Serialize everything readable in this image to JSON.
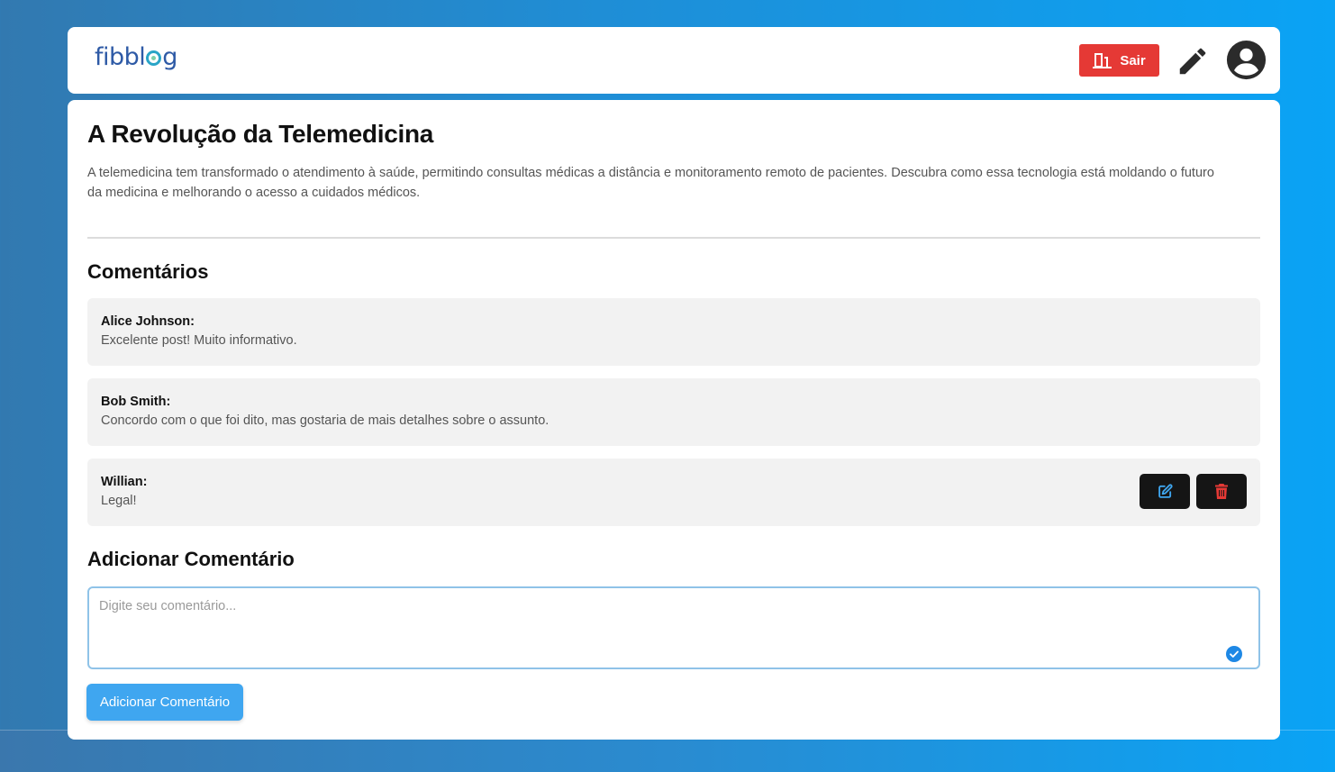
{
  "header": {
    "logo_prefix": "fibbl",
    "logo_suffix": "g",
    "logout_label": "Sair"
  },
  "post": {
    "title": "A Revolução da Telemedicina",
    "body": "A telemedicina tem transformado o atendimento à saúde, permitindo consultas médicas a distância e monitoramento remoto de pacientes. Descubra como essa tecnologia está moldando o futuro da medicina e melhorando o acesso a cuidados médicos."
  },
  "comments": {
    "title": "Comentários",
    "items": [
      {
        "author": "Alice Johnson:",
        "text": "Excelente post! Muito informativo."
      },
      {
        "author": "Bob Smith:",
        "text": "Concordo com o que foi dito, mas gostaria de mais detalhes sobre o assunto."
      },
      {
        "author": "Willian:",
        "text": "Legal!"
      }
    ]
  },
  "add_comment": {
    "title": "Adicionar Comentário",
    "placeholder": "Digite seu comentário...",
    "button_label": "Adicionar Comentário"
  },
  "colors": {
    "brand": "#2e5aa6",
    "logout": "#e53935",
    "accent": "#3fa6f0",
    "edit_icon": "#3fa6f0",
    "delete_icon": "#e53935"
  },
  "icons": {
    "logout": "door-exit-icon",
    "write": "pencil-icon",
    "account": "user-circle-icon",
    "edit": "edit-icon",
    "delete": "trash-icon",
    "input_status": "check-circle-icon"
  }
}
